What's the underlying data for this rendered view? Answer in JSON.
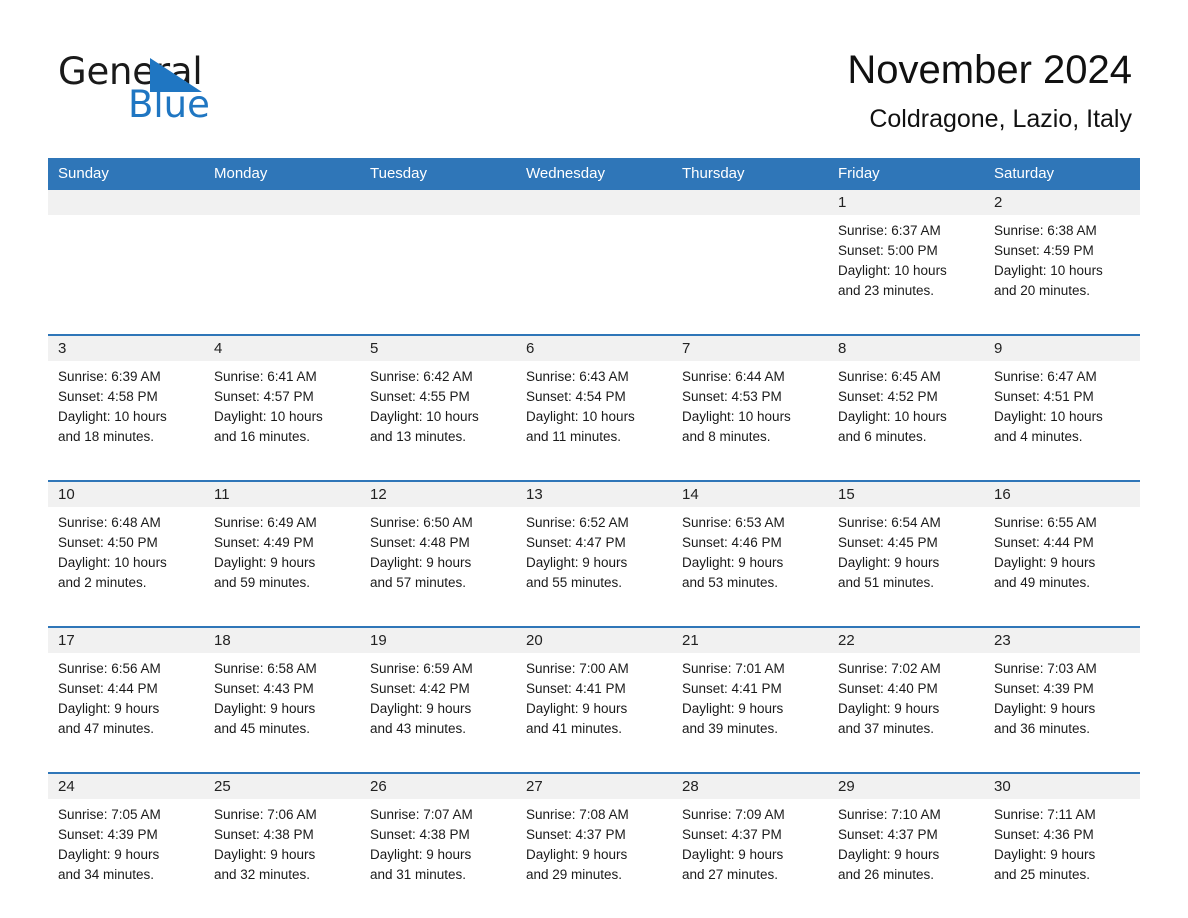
{
  "brand": {
    "name_part1": "General",
    "name_part2": "Blue",
    "triangle_color": "#1f76c2",
    "text_color": "#1a1a1a"
  },
  "header": {
    "title": "November 2024",
    "subtitle": "Coldragone, Lazio, Italy"
  },
  "theme": {
    "header_blue": "#2f76b8",
    "row_rule_blue": "#2f76b8",
    "day_band_gray": "#f1f1f1",
    "page_background": "#ffffff"
  },
  "calendar": {
    "weekdays": [
      "Sunday",
      "Monday",
      "Tuesday",
      "Wednesday",
      "Thursday",
      "Friday",
      "Saturday"
    ],
    "weeks": [
      [
        {
          "day": "",
          "lines": []
        },
        {
          "day": "",
          "lines": []
        },
        {
          "day": "",
          "lines": []
        },
        {
          "day": "",
          "lines": []
        },
        {
          "day": "",
          "lines": []
        },
        {
          "day": "1",
          "lines": [
            "Sunrise: 6:37 AM",
            "Sunset: 5:00 PM",
            "Daylight: 10 hours",
            "and 23 minutes."
          ]
        },
        {
          "day": "2",
          "lines": [
            "Sunrise: 6:38 AM",
            "Sunset: 4:59 PM",
            "Daylight: 10 hours",
            "and 20 minutes."
          ]
        }
      ],
      [
        {
          "day": "3",
          "lines": [
            "Sunrise: 6:39 AM",
            "Sunset: 4:58 PM",
            "Daylight: 10 hours",
            "and 18 minutes."
          ]
        },
        {
          "day": "4",
          "lines": [
            "Sunrise: 6:41 AM",
            "Sunset: 4:57 PM",
            "Daylight: 10 hours",
            "and 16 minutes."
          ]
        },
        {
          "day": "5",
          "lines": [
            "Sunrise: 6:42 AM",
            "Sunset: 4:55 PM",
            "Daylight: 10 hours",
            "and 13 minutes."
          ]
        },
        {
          "day": "6",
          "lines": [
            "Sunrise: 6:43 AM",
            "Sunset: 4:54 PM",
            "Daylight: 10 hours",
            "and 11 minutes."
          ]
        },
        {
          "day": "7",
          "lines": [
            "Sunrise: 6:44 AM",
            "Sunset: 4:53 PM",
            "Daylight: 10 hours",
            "and 8 minutes."
          ]
        },
        {
          "day": "8",
          "lines": [
            "Sunrise: 6:45 AM",
            "Sunset: 4:52 PM",
            "Daylight: 10 hours",
            "and 6 minutes."
          ]
        },
        {
          "day": "9",
          "lines": [
            "Sunrise: 6:47 AM",
            "Sunset: 4:51 PM",
            "Daylight: 10 hours",
            "and 4 minutes."
          ]
        }
      ],
      [
        {
          "day": "10",
          "lines": [
            "Sunrise: 6:48 AM",
            "Sunset: 4:50 PM",
            "Daylight: 10 hours",
            "and 2 minutes."
          ]
        },
        {
          "day": "11",
          "lines": [
            "Sunrise: 6:49 AM",
            "Sunset: 4:49 PM",
            "Daylight: 9 hours",
            "and 59 minutes."
          ]
        },
        {
          "day": "12",
          "lines": [
            "Sunrise: 6:50 AM",
            "Sunset: 4:48 PM",
            "Daylight: 9 hours",
            "and 57 minutes."
          ]
        },
        {
          "day": "13",
          "lines": [
            "Sunrise: 6:52 AM",
            "Sunset: 4:47 PM",
            "Daylight: 9 hours",
            "and 55 minutes."
          ]
        },
        {
          "day": "14",
          "lines": [
            "Sunrise: 6:53 AM",
            "Sunset: 4:46 PM",
            "Daylight: 9 hours",
            "and 53 minutes."
          ]
        },
        {
          "day": "15",
          "lines": [
            "Sunrise: 6:54 AM",
            "Sunset: 4:45 PM",
            "Daylight: 9 hours",
            "and 51 minutes."
          ]
        },
        {
          "day": "16",
          "lines": [
            "Sunrise: 6:55 AM",
            "Sunset: 4:44 PM",
            "Daylight: 9 hours",
            "and 49 minutes."
          ]
        }
      ],
      [
        {
          "day": "17",
          "lines": [
            "Sunrise: 6:56 AM",
            "Sunset: 4:44 PM",
            "Daylight: 9 hours",
            "and 47 minutes."
          ]
        },
        {
          "day": "18",
          "lines": [
            "Sunrise: 6:58 AM",
            "Sunset: 4:43 PM",
            "Daylight: 9 hours",
            "and 45 minutes."
          ]
        },
        {
          "day": "19",
          "lines": [
            "Sunrise: 6:59 AM",
            "Sunset: 4:42 PM",
            "Daylight: 9 hours",
            "and 43 minutes."
          ]
        },
        {
          "day": "20",
          "lines": [
            "Sunrise: 7:00 AM",
            "Sunset: 4:41 PM",
            "Daylight: 9 hours",
            "and 41 minutes."
          ]
        },
        {
          "day": "21",
          "lines": [
            "Sunrise: 7:01 AM",
            "Sunset: 4:41 PM",
            "Daylight: 9 hours",
            "and 39 minutes."
          ]
        },
        {
          "day": "22",
          "lines": [
            "Sunrise: 7:02 AM",
            "Sunset: 4:40 PM",
            "Daylight: 9 hours",
            "and 37 minutes."
          ]
        },
        {
          "day": "23",
          "lines": [
            "Sunrise: 7:03 AM",
            "Sunset: 4:39 PM",
            "Daylight: 9 hours",
            "and 36 minutes."
          ]
        }
      ],
      [
        {
          "day": "24",
          "lines": [
            "Sunrise: 7:05 AM",
            "Sunset: 4:39 PM",
            "Daylight: 9 hours",
            "and 34 minutes."
          ]
        },
        {
          "day": "25",
          "lines": [
            "Sunrise: 7:06 AM",
            "Sunset: 4:38 PM",
            "Daylight: 9 hours",
            "and 32 minutes."
          ]
        },
        {
          "day": "26",
          "lines": [
            "Sunrise: 7:07 AM",
            "Sunset: 4:38 PM",
            "Daylight: 9 hours",
            "and 31 minutes."
          ]
        },
        {
          "day": "27",
          "lines": [
            "Sunrise: 7:08 AM",
            "Sunset: 4:37 PM",
            "Daylight: 9 hours",
            "and 29 minutes."
          ]
        },
        {
          "day": "28",
          "lines": [
            "Sunrise: 7:09 AM",
            "Sunset: 4:37 PM",
            "Daylight: 9 hours",
            "and 27 minutes."
          ]
        },
        {
          "day": "29",
          "lines": [
            "Sunrise: 7:10 AM",
            "Sunset: 4:37 PM",
            "Daylight: 9 hours",
            "and 26 minutes."
          ]
        },
        {
          "day": "30",
          "lines": [
            "Sunrise: 7:11 AM",
            "Sunset: 4:36 PM",
            "Daylight: 9 hours",
            "and 25 minutes."
          ]
        }
      ]
    ]
  }
}
